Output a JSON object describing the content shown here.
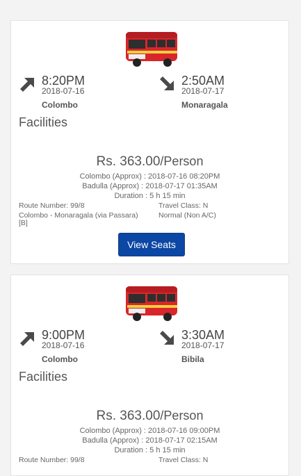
{
  "trips": [
    {
      "departure": {
        "time": "8:20PM",
        "date": "2018-07-16",
        "city": "Colombo"
      },
      "arrival": {
        "time": "2:50AM",
        "date": "2018-07-17",
        "city": "Monaragala"
      },
      "facilities_label": "Facilities",
      "price": "Rs. 363.00",
      "price_unit": "/Person",
      "schedule": [
        "Colombo (Approx) : 2018-07-16 08:20PM",
        "Badulla (Approx) : 2018-07-17 01:35AM",
        "Duration : 5 h 15 min"
      ],
      "route_number": "Route Number: 99/8",
      "route_text": "Colombo - Monaragala (via Passara) [B]",
      "travel_class": "Travel Class: N",
      "travel_class_value": "Normal (Non A/C)",
      "button_label": "View Seats"
    },
    {
      "departure": {
        "time": "9:00PM",
        "date": "2018-07-16",
        "city": "Colombo"
      },
      "arrival": {
        "time": "3:30AM",
        "date": "2018-07-17",
        "city": "Bibila"
      },
      "facilities_label": "Facilities",
      "price": "Rs. 363.00",
      "price_unit": "/Person",
      "schedule": [
        "Colombo (Approx) : 2018-07-16 09:00PM",
        "Badulla (Approx) : 2018-07-17 02:15AM",
        "Duration : 5 h 15 min"
      ],
      "route_number": "Route Number: 99/8",
      "route_text": "",
      "travel_class": "Travel Class: N",
      "travel_class_value": "",
      "button_label": ""
    }
  ],
  "colors": {
    "button": "#0b47a4",
    "bus_red": "#d8262b",
    "icon_gray": "#4a4a4a"
  }
}
